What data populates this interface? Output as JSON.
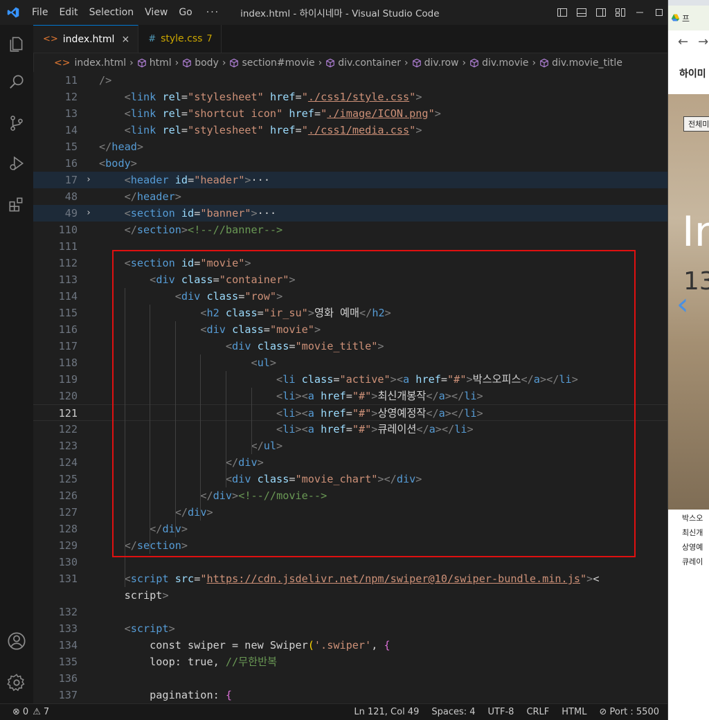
{
  "titlebar": {
    "menus": [
      "File",
      "Edit",
      "Selection",
      "View",
      "Go"
    ],
    "more": "···",
    "window_title": "index.html - 하이시네마 - Visual Studio Code"
  },
  "tabs": [
    {
      "icon": "<>",
      "label": "index.html",
      "close": "×"
    },
    {
      "icon": "#",
      "label": "style.css",
      "badge": "7"
    }
  ],
  "breadcrumb": [
    "index.html",
    "html",
    "body",
    "section#movie",
    "div.container",
    "div.row",
    "div.movie",
    "div.movie_title"
  ],
  "editor": {
    "lines": [
      {
        "n": "11",
        "t": "/>"
      },
      {
        "n": "12",
        "t": "    <link rel=\"stylesheet\" href=\"./css1/style.css\">"
      },
      {
        "n": "13",
        "t": "    <link rel=\"shortcut icon\" href=\"./image/ICON.png\">"
      },
      {
        "n": "14",
        "t": "    <link rel=\"stylesheet\" href=\"./css1/media.css\">"
      },
      {
        "n": "15",
        "t": "</head>"
      },
      {
        "n": "16",
        "t": "<body>"
      },
      {
        "n": "17",
        "t": "    <header id=\"header\">···"
      },
      {
        "n": "48",
        "t": "    </header>"
      },
      {
        "n": "49",
        "t": "    <section id=\"banner\">···"
      },
      {
        "n": "110",
        "t": "    </section><!--//banner-->"
      },
      {
        "n": "111",
        "t": ""
      },
      {
        "n": "112",
        "t": "    <section id=\"movie\">"
      },
      {
        "n": "113",
        "t": "        <div class=\"container\">"
      },
      {
        "n": "114",
        "t": "            <div class=\"row\">"
      },
      {
        "n": "115",
        "t": "                <h2 class=\"ir_su\">영화 예매</h2>"
      },
      {
        "n": "116",
        "t": "                <div class=\"movie\">"
      },
      {
        "n": "117",
        "t": "                    <div class=\"movie_title\">"
      },
      {
        "n": "118",
        "t": "                        <ul>"
      },
      {
        "n": "119",
        "t": "                            <li class=\"active\"><a href=\"#\">박스오피스</a></li>"
      },
      {
        "n": "120",
        "t": "                            <li><a href=\"#\">최신개봉작</a></li>"
      },
      {
        "n": "121",
        "t": "                            <li><a href=\"#\">상영예정작</a></li>"
      },
      {
        "n": "122",
        "t": "                            <li><a href=\"#\">큐레이션</a></li>"
      },
      {
        "n": "123",
        "t": "                        </ul>"
      },
      {
        "n": "124",
        "t": "                    </div>"
      },
      {
        "n": "125",
        "t": "                    <div class=\"movie_chart\"></div>"
      },
      {
        "n": "126",
        "t": "                </div><!--//movie-->"
      },
      {
        "n": "127",
        "t": "            </div>"
      },
      {
        "n": "128",
        "t": "        </div>"
      },
      {
        "n": "129",
        "t": "    </section>"
      },
      {
        "n": "130",
        "t": ""
      },
      {
        "n": "131",
        "t": "    <script src=\"https://cdn.jsdelivr.net/npm/swiper@10/swiper-bundle.min.js\"><"
      },
      {
        "n": "",
        "t": "    script>"
      },
      {
        "n": "132",
        "t": ""
      },
      {
        "n": "133",
        "t": "    <script>"
      },
      {
        "n": "134",
        "t": "        const swiper = new Swiper('.swiper', {"
      },
      {
        "n": "135",
        "t": "        loop: true, //무한반복"
      },
      {
        "n": "136",
        "t": ""
      },
      {
        "n": "137",
        "t": "        pagination: {"
      }
    ]
  },
  "status": {
    "errors": "0",
    "warnings": "7",
    "position": "Ln 121, Col 49",
    "spaces": "Spaces: 4",
    "encoding": "UTF-8",
    "eol": "CRLF",
    "language": "HTML",
    "port": "Port : 5500"
  },
  "browser": {
    "tab_label": "프",
    "site_title": "하이미",
    "all_button": "전체미",
    "banner_big": "In",
    "banner_num": "13",
    "list": [
      "박스오",
      "최신개",
      "상영예",
      "큐레이"
    ]
  },
  "colors": {
    "accent": "#0078d4",
    "highlight_box": "#e01010",
    "background": "#1f1f1f"
  }
}
